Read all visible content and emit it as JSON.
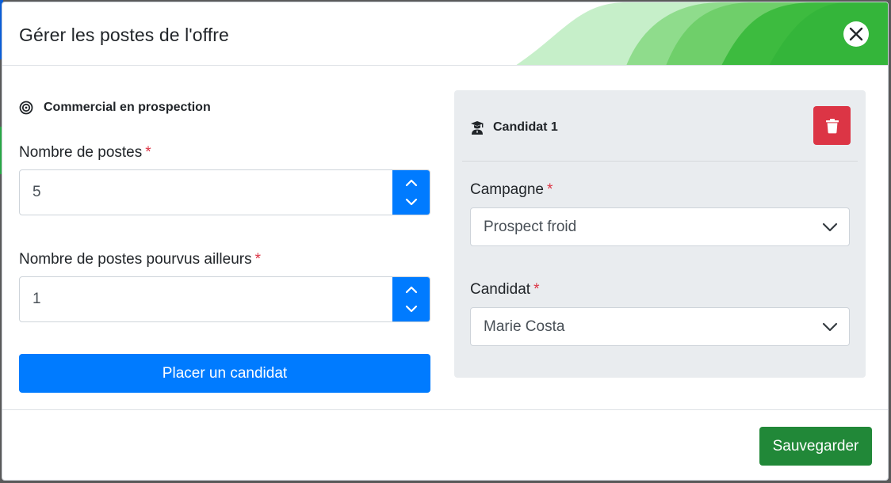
{
  "modal": {
    "title": "Gérer les postes de l'offre",
    "close_icon": "close-icon"
  },
  "left": {
    "section_title": "Commercial en prospection",
    "section_icon": "target-icon",
    "nombre_postes": {
      "label": "Nombre de postes",
      "required": "*",
      "value": "5"
    },
    "postes_pourvus": {
      "label": "Nombre de postes pourvus ailleurs",
      "required": "*",
      "value": "1"
    },
    "place_button": "Placer un candidat"
  },
  "candidate": {
    "title": "Candidat 1",
    "title_icon": "graduate-icon",
    "delete_icon": "trash-icon",
    "campagne": {
      "label": "Campagne",
      "required": "*",
      "selected": "Prospect froid"
    },
    "candidat": {
      "label": "Candidat",
      "required": "*",
      "selected": "Marie Costa"
    }
  },
  "footer": {
    "save_button": "Sauvegarder"
  },
  "colors": {
    "primary": "#007bff",
    "danger": "#dc3545",
    "success": "#218838",
    "panel": "#e9ecef"
  }
}
